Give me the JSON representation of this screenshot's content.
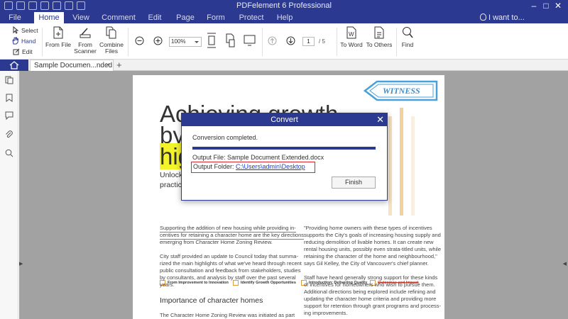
{
  "app": {
    "title": "PDFelement 6 Professional",
    "accent": "#2b3990"
  },
  "menu": {
    "items": [
      "File",
      "Home",
      "View",
      "Comment",
      "Edit",
      "Page",
      "Form",
      "Protect",
      "Help"
    ],
    "active": "Home",
    "search_hint": "I want to..."
  },
  "ribbon": {
    "select": "Select",
    "hand": "Hand",
    "edit": "Edit",
    "from_file": "From File",
    "from_scanner": [
      "From",
      "Scanner"
    ],
    "combine_files": [
      "Combine",
      "Files"
    ],
    "zoom": "100%",
    "page_current": "1",
    "page_total": "/ 5",
    "to_word": "To Word",
    "to_others": "To Others",
    "find": "Find"
  },
  "tabs": {
    "document": "Sample Documen...nded",
    "close": "×",
    "add": "+"
  },
  "document": {
    "stamp": "WITNESS",
    "headline": [
      "Achieving growth",
      "by",
      "hig"
    ],
    "intro": [
      "Unlock g",
      "practice"
    ],
    "features": [
      "From Improvement to Innovation",
      "Identify Growth Opportunities",
      "Introduction: Delivering Quality",
      "Outcomes and Impact"
    ],
    "col1_lines": [
      "Supporting the addition of new housing while providing in-",
      "centives for retaining a character home are the key directions",
      "emerging from Character Home Zoning Review.",
      "",
      "City staff provided an update to Council today that summa-",
      "rized the main highlights of what we've heard through recent",
      "public consultation and feedback from stakeholders, studies",
      "by consultants, and analysis by staff over the past several",
      "years."
    ],
    "subheading": "Importance of character homes",
    "col1_tail": "The Character Home Zoning Review was initiated as part",
    "col2_lines": [
      "\"Providing home owners with these types of incentives",
      "supports the City's goals of increasing housing supply and",
      "reducing demolition of livable homes.  It can create new",
      "rental housing units, possibly even strata-titled units, while",
      "retaining the character of the home and neighbourhood,\"",
      "says Gil Kelley, the City of Vancouver's chief planner.",
      "",
      "Staff have heard generally strong support for these kinds",
      "of incentives for homeowners who wish to pursue them.",
      "Additional directions being explored include refining and",
      "updating the character home criteria and providing more",
      "support for retention through grant programs and process-",
      "ing improvements."
    ]
  },
  "dialog": {
    "title": "Convert",
    "message": "Conversion completed.",
    "progress": 1.0,
    "output_file_label": "Output File:",
    "output_file": "Sample Document Extended.docx",
    "output_folder_label": "Output Folder:",
    "output_folder": "C:\\Users\\admin\\Desktop",
    "finish": "Finish"
  }
}
